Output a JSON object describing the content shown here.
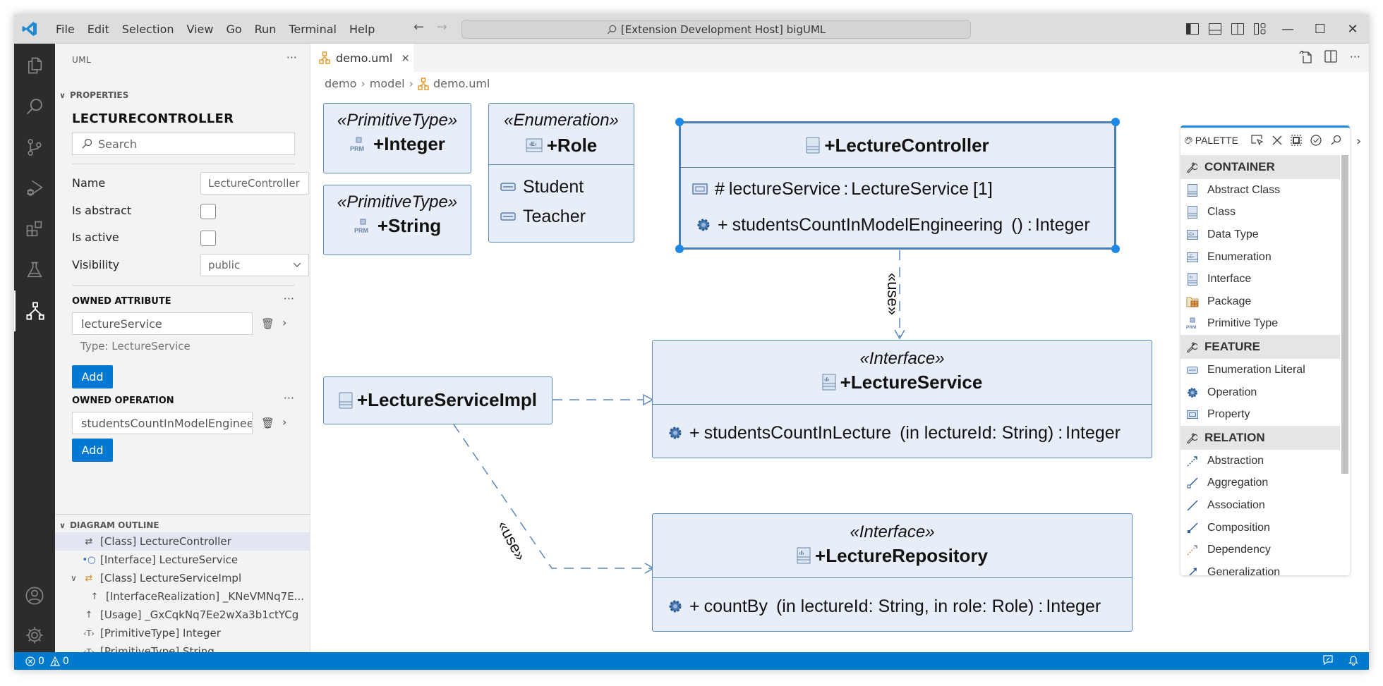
{
  "titlebar": {
    "menu": [
      "File",
      "Edit",
      "Selection",
      "View",
      "Go",
      "Run",
      "Terminal",
      "Help"
    ],
    "command_center": "[Extension Development Host] bigUML",
    "back": "←",
    "forward": "→",
    "minimize": "—",
    "maximize": "☐",
    "close": "✕"
  },
  "sidebar": {
    "title": "UML",
    "more": "···",
    "properties": {
      "section_label": "PROPERTIES",
      "element_title": "LECTURECONTROLLER",
      "search_placeholder": "Search",
      "fields": {
        "name_label": "Name",
        "name_value": "LectureController",
        "is_abstract_label": "Is abstract",
        "is_abstract_checked": false,
        "is_active_label": "Is active",
        "is_active_checked": false,
        "visibility_label": "Visibility",
        "visibility_value": "public"
      },
      "owned_attribute": {
        "label": "OWNED ATTRIBUTE",
        "more": "···",
        "items": [
          {
            "value": "lectureService",
            "type_hint": "Type: LectureService"
          }
        ],
        "add_label": "Add"
      },
      "owned_operation": {
        "label": "OWNED OPERATION",
        "more": "···",
        "items": [
          {
            "value": "studentsCountInModelEngineering"
          }
        ],
        "add_label": "Add"
      }
    },
    "outline": {
      "section_label": "DIAGRAM OUTLINE",
      "items": [
        {
          "icon": "class-icon",
          "label": "[Class] LectureController",
          "selected": true
        },
        {
          "icon": "interface-icon",
          "label": "[Interface] LectureService"
        },
        {
          "icon": "class-icon",
          "label": "[Class] LectureServiceImpl",
          "expanded": true
        },
        {
          "icon": "arrow-up-icon",
          "label": "[InterfaceRealization] _KNeVMNq7E..."
        },
        {
          "icon": "arrow-up-icon",
          "label": "[Usage] _GxCqkNq7Ee2wXa3b1ctYCg"
        },
        {
          "icon": "primitive-type-icon",
          "label": "[PrimitiveType] Integer"
        },
        {
          "icon": "primitive-type-icon",
          "label": "[PrimitiveType] String"
        }
      ]
    }
  },
  "editor": {
    "tab": {
      "label": "demo.uml",
      "close": "×"
    },
    "breadcrumb": [
      "demo",
      "model",
      "demo.uml"
    ],
    "diagram": {
      "nodes": {
        "integer": {
          "stereotype": "«PrimitiveType»",
          "name": "+Integer"
        },
        "string": {
          "stereotype": "«PrimitiveType»",
          "name": "+String"
        },
        "role": {
          "stereotype": "«Enumeration»",
          "name": "+Role",
          "literals": [
            "Student",
            "Teacher"
          ]
        },
        "lecture_controller": {
          "name": "+LectureController",
          "attributes": [
            {
              "visibility": "#",
              "name": "lectureService",
              "type": "LectureService",
              "multiplicity": "[1]"
            }
          ],
          "operations": [
            {
              "visibility": "+",
              "name": "studentsCountInModelEngineering",
              "params": "()",
              "return": "Integer"
            }
          ]
        },
        "lecture_service": {
          "stereotype": "«Interface»",
          "name": "+LectureService",
          "operations": [
            {
              "visibility": "+",
              "name": "studentsCountInLecture",
              "params": "(in lectureId: String)",
              "return": "Integer"
            }
          ]
        },
        "lecture_service_impl": {
          "name": "+LectureServiceImpl"
        },
        "lecture_repository": {
          "stereotype": "«Interface»",
          "name": "+LectureRepository",
          "operations": [
            {
              "visibility": "+",
              "name": "countBy",
              "params": "(in lectureId: String, in role: Role)",
              "return": "Integer"
            }
          ]
        }
      },
      "edges": {
        "usage_controller_service": "«use»",
        "usage_impl_repository": "«use»"
      }
    }
  },
  "palette": {
    "title": "PALETTE",
    "collapse": "›",
    "groups": [
      {
        "label": "CONTAINER",
        "items": [
          {
            "icon": "abstract-class-icon",
            "label": "Abstract Class"
          },
          {
            "icon": "class-icon",
            "label": "Class"
          },
          {
            "icon": "data-type-icon",
            "label": "Data Type"
          },
          {
            "icon": "enumeration-icon",
            "label": "Enumeration"
          },
          {
            "icon": "interface-icon",
            "label": "Interface"
          },
          {
            "icon": "package-icon",
            "label": "Package"
          },
          {
            "icon": "primitive-type-icon",
            "label": "Primitive Type"
          }
        ]
      },
      {
        "label": "FEATURE",
        "items": [
          {
            "icon": "enumeration-literal-icon",
            "label": "Enumeration Literal"
          },
          {
            "icon": "operation-icon",
            "label": "Operation"
          },
          {
            "icon": "property-icon",
            "label": "Property"
          }
        ]
      },
      {
        "label": "RELATION",
        "items": [
          {
            "icon": "abstraction-icon",
            "label": "Abstraction"
          },
          {
            "icon": "aggregation-icon",
            "label": "Aggregation"
          },
          {
            "icon": "association-icon",
            "label": "Association"
          },
          {
            "icon": "composition-icon",
            "label": "Composition"
          },
          {
            "icon": "dependency-icon",
            "label": "Dependency"
          },
          {
            "icon": "generalization-icon",
            "label": "Generalization"
          }
        ]
      }
    ]
  },
  "statusbar": {
    "errors": "0",
    "warnings": "0"
  },
  "colors": {
    "accent": "#0078d4",
    "statusbar": "#007acc",
    "node_fill": "#e8eef7",
    "node_border": "#5b88b9",
    "selection_handle": "#1e88e5"
  }
}
